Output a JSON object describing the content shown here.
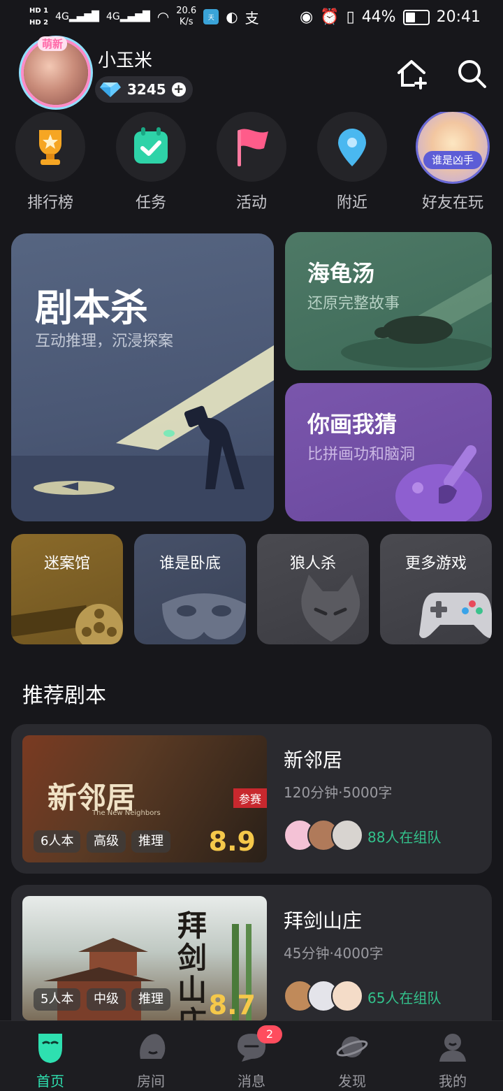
{
  "status_bar": {
    "hd1": "HD 1",
    "hd2": "HD 2",
    "signal1": "4G",
    "signal2": "4G",
    "net_speed": "20.6",
    "net_unit": "K/s",
    "battery": "44%",
    "time": "20:41"
  },
  "profile": {
    "badge": "萌新",
    "name": "小玉米",
    "gems": "3245"
  },
  "quick_nav": [
    {
      "label": "排行榜",
      "icon": "trophy-icon"
    },
    {
      "label": "任务",
      "icon": "task-icon"
    },
    {
      "label": "活动",
      "icon": "flag-icon"
    },
    {
      "label": "附近",
      "icon": "location-icon"
    },
    {
      "label": "好友在玩",
      "icon": "friend-avatar",
      "tag": "谁是凶手"
    }
  ],
  "games": {
    "jubensha": {
      "title": "剧本杀",
      "subtitle": "互动推理，沉浸探案"
    },
    "haiguitang": {
      "title": "海龟汤",
      "subtitle": "还原完整故事"
    },
    "nihuawocai": {
      "title": "你画我猜",
      "subtitle": "比拼画功和脑洞"
    },
    "small": [
      {
        "label": "迷案馆"
      },
      {
        "label": "谁是卧底"
      },
      {
        "label": "狼人杀"
      },
      {
        "label": "更多游戏"
      }
    ]
  },
  "recommend": {
    "title": "推荐剧本",
    "items": [
      {
        "cover_title": "新邻居",
        "cover_sub": "The New Neighbors",
        "cover_badge": "参赛",
        "tags": [
          "6人本",
          "高级",
          "推理"
        ],
        "score": "8.9",
        "title": "新邻居",
        "meta": "120分钟·5000字",
        "team": "88人在组队"
      },
      {
        "cover_title": "拜剑山庄",
        "tags": [
          "5人本",
          "中级",
          "推理"
        ],
        "score": "8.7",
        "title": "拜剑山庄",
        "meta": "45分钟·4000字",
        "team": "65人在组队"
      }
    ]
  },
  "bottom_nav": [
    {
      "label": "首页",
      "active": true
    },
    {
      "label": "房间"
    },
    {
      "label": "消息",
      "badge": "2"
    },
    {
      "label": "发现"
    },
    {
      "label": "我的"
    }
  ],
  "colors": {
    "accent": "#2ee0b0",
    "team_green": "#33c28c",
    "score_gold": "#f5c84a",
    "badge_red": "#ff4d5e"
  }
}
